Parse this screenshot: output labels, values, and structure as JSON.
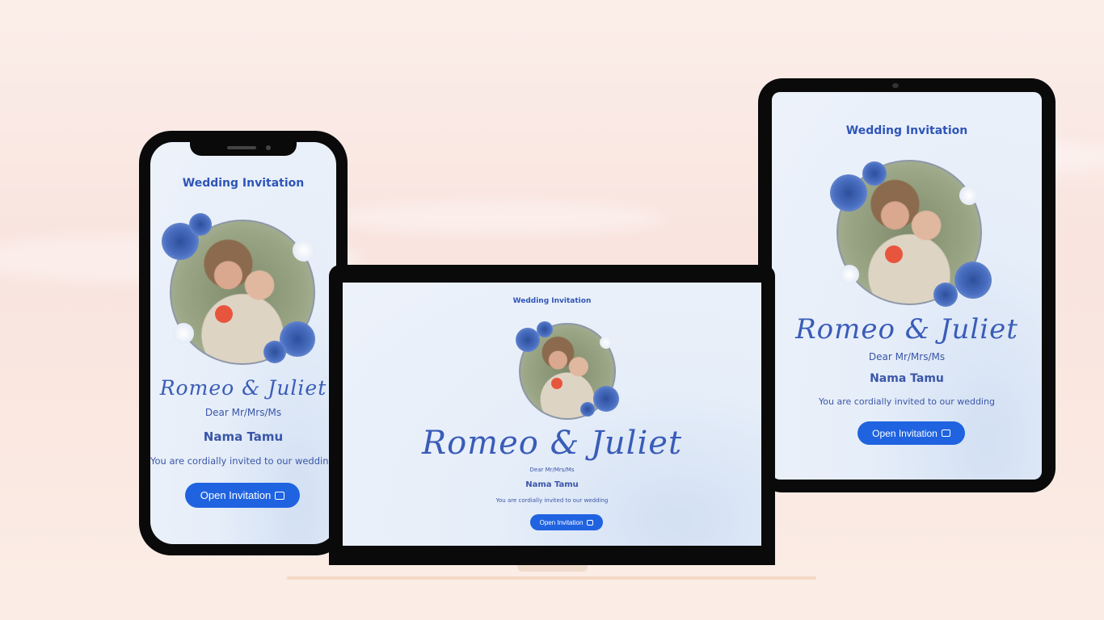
{
  "invitation": {
    "title": "Wedding Invitation",
    "names": "Romeo & Juliet",
    "greeting": "Dear Mr/Mrs/Ms",
    "guest_name": "Nama Tamu",
    "message": "You are cordially invited to our wedding",
    "button_label": "Open Invitation",
    "button_icon": "envelope-icon"
  },
  "colors": {
    "accent": "#1f63e0",
    "text": "#2f55b8",
    "background": "#fae8e1",
    "device": "#0a0a0a"
  }
}
